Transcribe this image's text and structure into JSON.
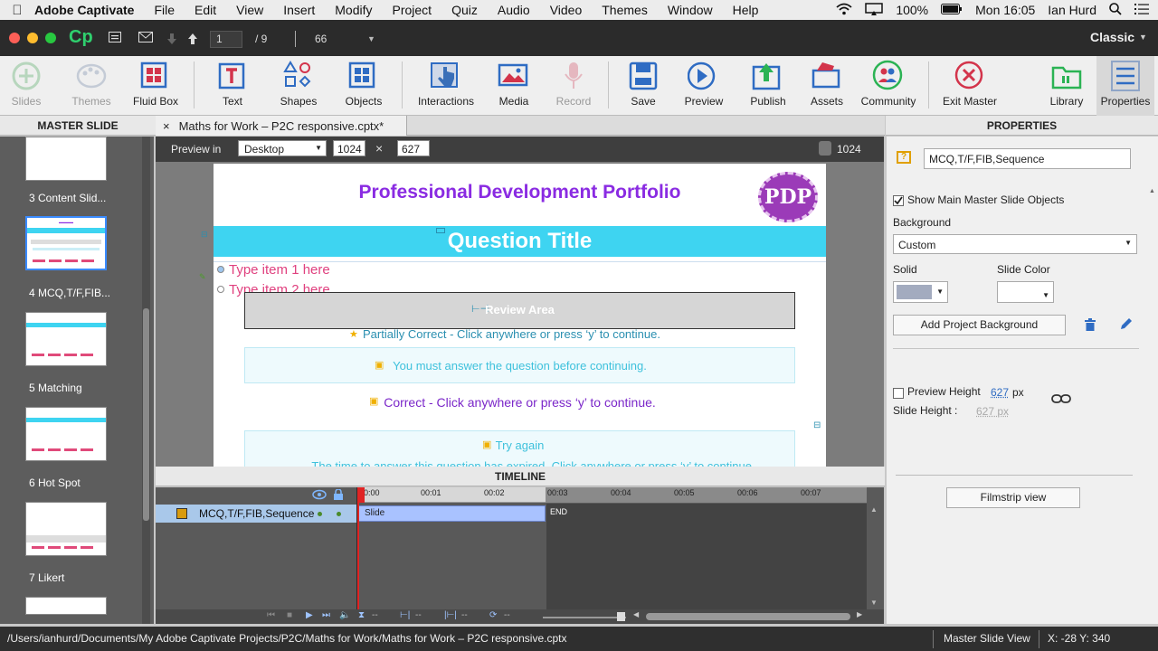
{
  "menubar": {
    "app": "Adobe Captivate",
    "items": [
      "File",
      "Edit",
      "View",
      "Insert",
      "Modify",
      "Project",
      "Quiz",
      "Audio",
      "Video",
      "Themes",
      "Window",
      "Help"
    ],
    "battery": "100%",
    "clock": "Mon 16:05",
    "user": "Ian Hurd"
  },
  "titlebar": {
    "logo": "Cp",
    "slide_current": "1",
    "slide_sep": "/ 9",
    "zoom": "66",
    "workspace": "Classic"
  },
  "toolbar": {
    "slides": "Slides",
    "themes": "Themes",
    "fluid_box": "Fluid Box",
    "text": "Text",
    "shapes": "Shapes",
    "objects": "Objects",
    "interactions": "Interactions",
    "media": "Media",
    "record": "Record",
    "save": "Save",
    "preview": "Preview",
    "publish": "Publish",
    "assets": "Assets",
    "community": "Community",
    "exit_master": "Exit Master",
    "library": "Library",
    "properties": "Properties"
  },
  "left_panel": {
    "title": "MASTER SLIDE",
    "thumbs": [
      {
        "label": "3 Content Slid..."
      },
      {
        "label": "4 MCQ,T/F,FIB..."
      },
      {
        "label": "5 Matching"
      },
      {
        "label": "6 Hot Spot"
      },
      {
        "label": "7 Likert"
      }
    ]
  },
  "doc_tab": {
    "close": "×",
    "title": "Maths for Work – P2C responsive.cptx*"
  },
  "stage": {
    "preview_in": "Preview in",
    "device": "Desktop",
    "width": "1024",
    "times": "×",
    "height": "627",
    "ruler_width": "1024",
    "slide": {
      "header": "Professional Development Portfolio",
      "logo": "PDP",
      "question_title": "Question Title",
      "item1": "Type item 1 here",
      "item2": "Type item 2 here",
      "review_area": "Review Area",
      "partially_correct": "Partially Correct - Click anywhere or press ‘y’ to continue.",
      "must_answer": "You must answer the question before continuing.",
      "correct": "Correct - Click anywhere or press ‘y’ to continue.",
      "try_again": "Try again",
      "expired": "The time to answer this question has expired. Click anywhere or press ‘y’ to continue."
    }
  },
  "timeline": {
    "title": "TIMELINE",
    "layer": "MCQ,T/F,FIB,Sequence",
    "ticks": [
      "00:00",
      "00:01",
      "00:02",
      "00:03",
      "00:04",
      "00:05",
      "00:06",
      "00:07"
    ],
    "slide_bar": "Slide",
    "end": "END",
    "dash1": "--",
    "dash2": "--",
    "dash3": "--",
    "dash4": "--"
  },
  "properties": {
    "title": "PROPERTIES",
    "name": "MCQ,T/F,FIB,Sequence",
    "show_master": "Show Main Master Slide Objects",
    "background_label": "Background",
    "background_value": "Custom",
    "solid": "Solid",
    "slide_color": "Slide Color",
    "add_bg": "Add Project Background",
    "preview_height": "Preview Height",
    "preview_height_val": "627",
    "px": "px",
    "slide_height": "Slide Height :",
    "slide_height_val": "627 px",
    "filmstrip": "Filmstrip view"
  },
  "statusbar": {
    "path": "/Users/ianhurd/Documents/My Adobe Captivate Projects/P2C/Maths for Work/Maths for Work – P2C responsive.cptx",
    "view": "Master Slide View",
    "coords": "X: -28 Y: 340"
  },
  "colors": {
    "accent_purple": "#8a2be2",
    "cyan_band": "#3ed4f1",
    "feedback_teal": "#2a8fb0",
    "feedback_purple": "#7b27c9"
  }
}
